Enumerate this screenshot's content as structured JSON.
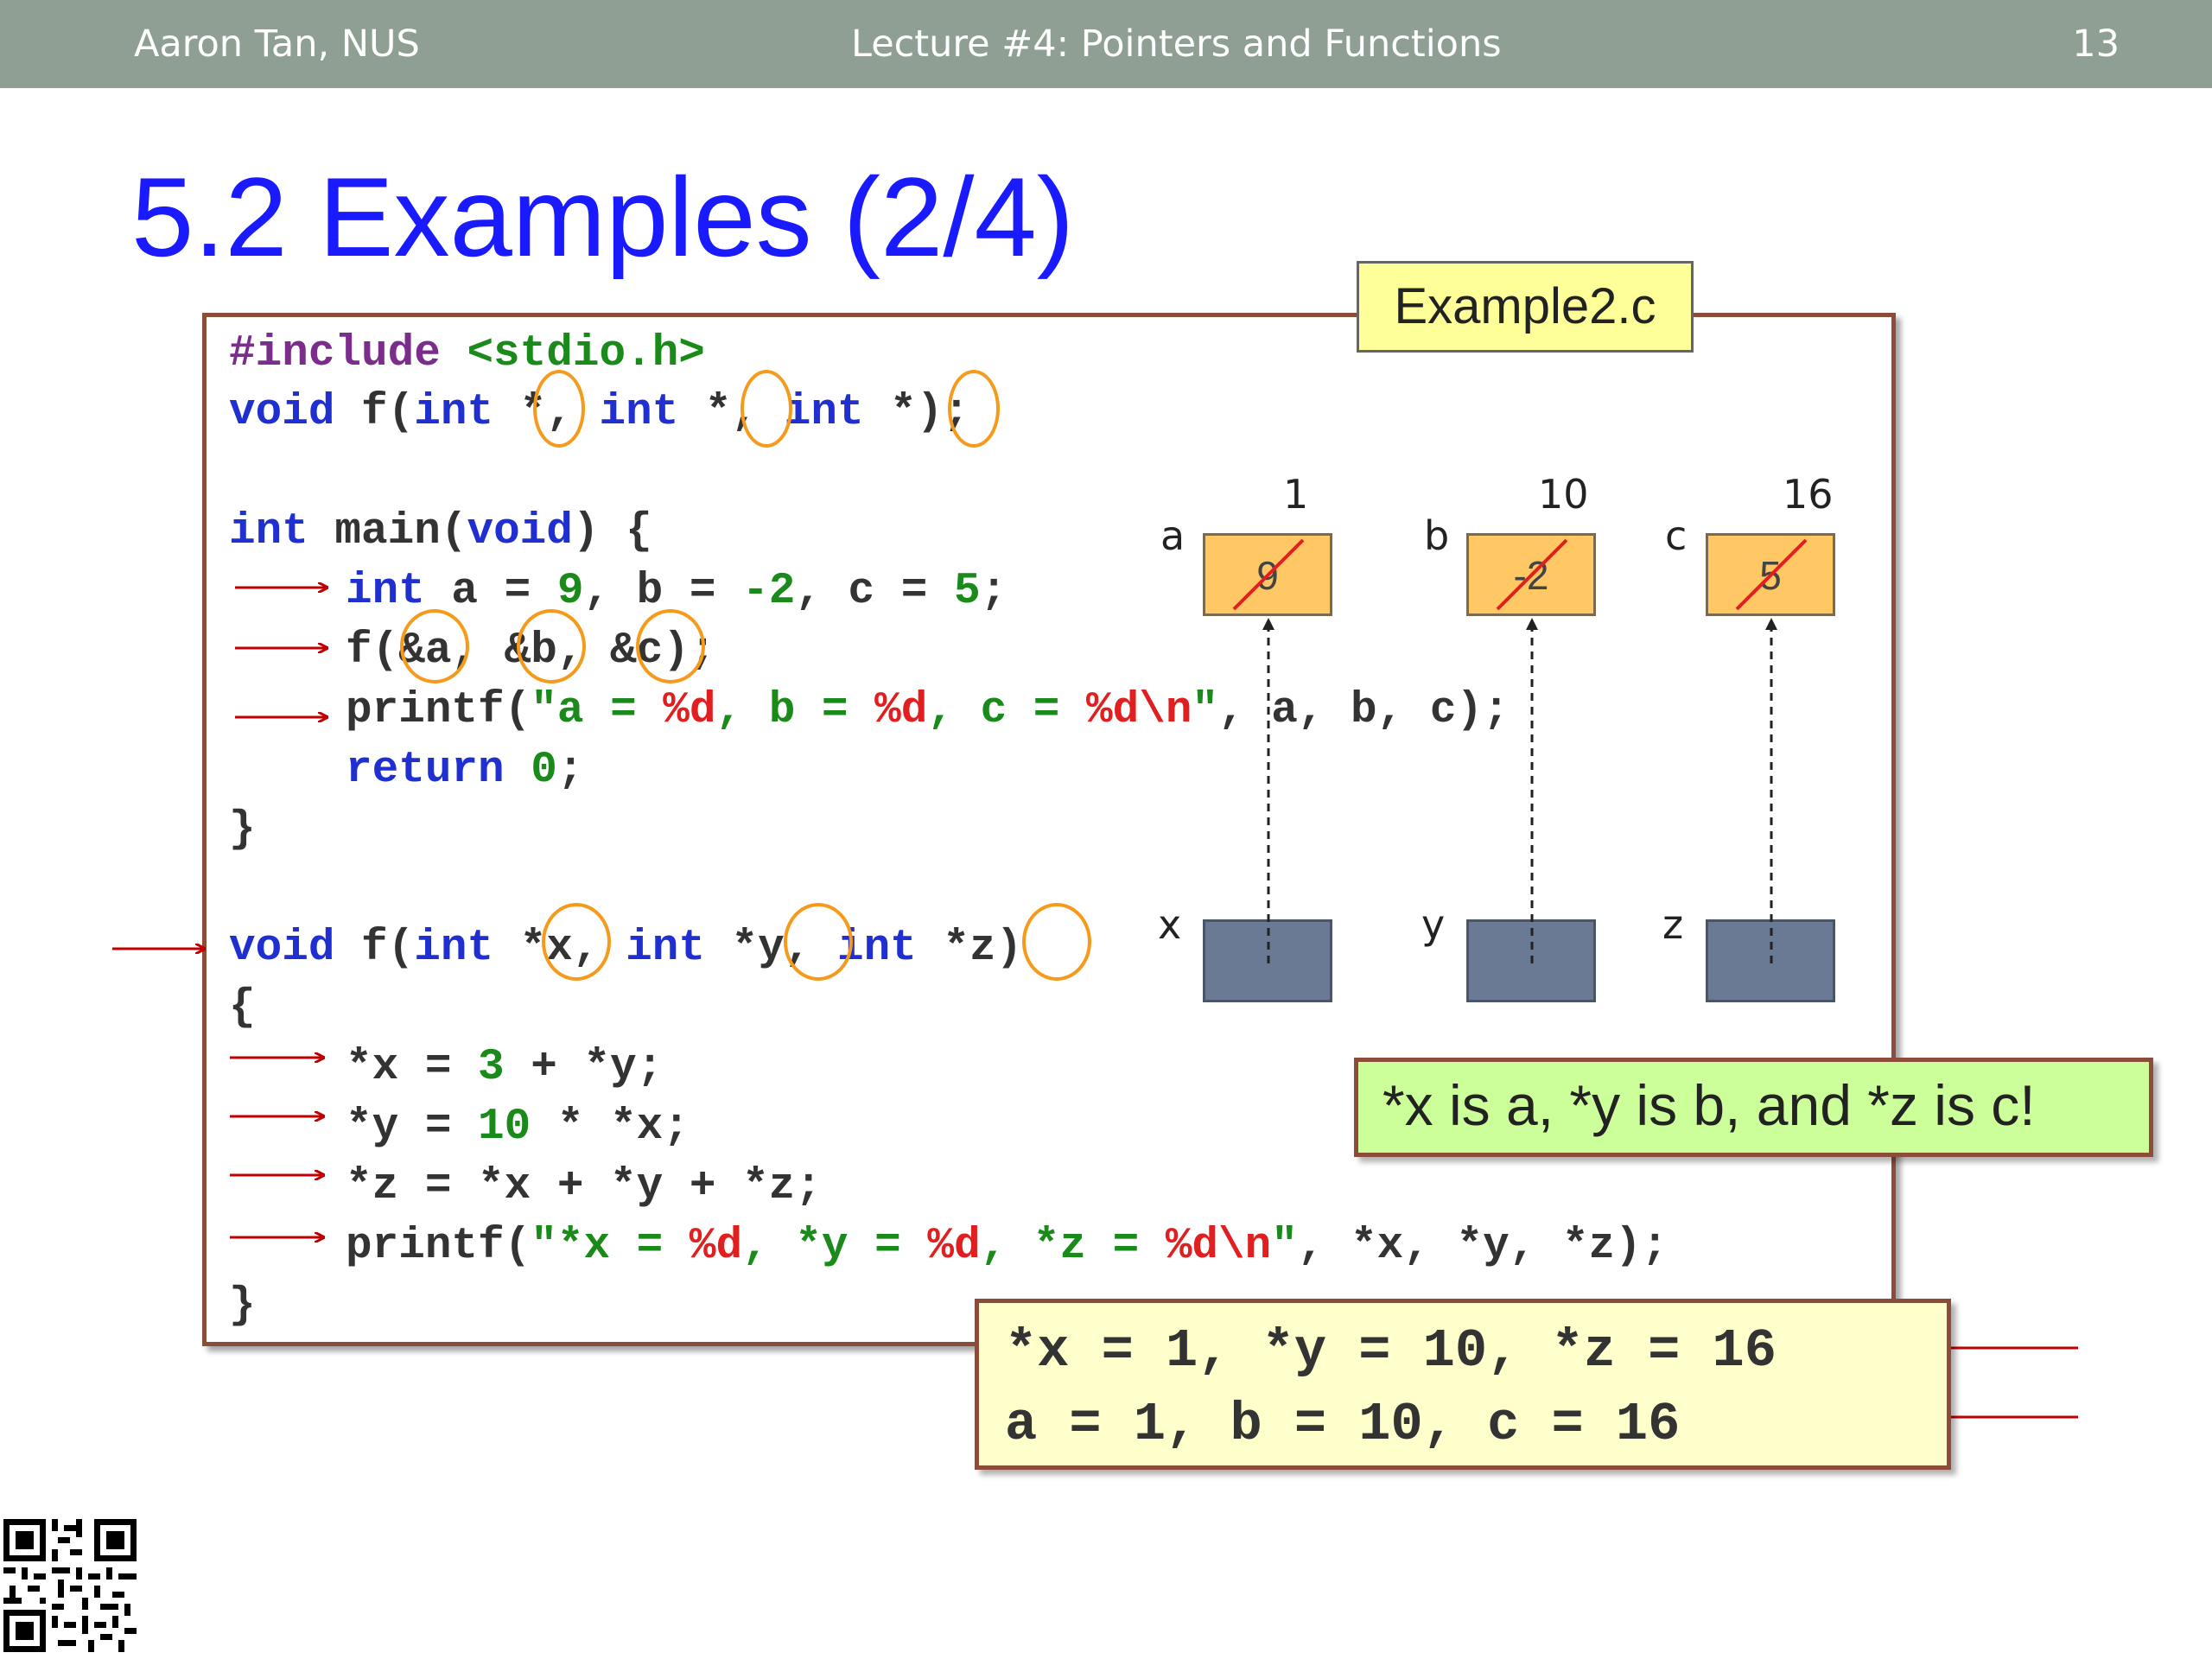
{
  "header": {
    "author": "Aaron Tan, NUS",
    "lecture": "Lecture #4: Pointers and Functions",
    "page_number": "13"
  },
  "slide": {
    "title": "5.2 Examples (2/4)",
    "filename": "Example2.c"
  },
  "code": {
    "l1_pp": "#include",
    "l1_inc": "<stdio.h>",
    "l2_void": "void",
    "l2_f": " f(",
    "l2_int1": "int",
    "l2_p1": " *, ",
    "l2_int2": "int",
    "l2_p2": " *, ",
    "l2_int3": "int",
    "l2_p3": " *);",
    "l3_int": "int",
    "l3_main": " main(",
    "l3_void": "void",
    "l3_rest": ") {",
    "l4_int": "int",
    "l4_a": " a = ",
    "l4_9": "9",
    "l4_b": ", b = ",
    "l4_m2": "-2",
    "l4_c": ", c = ",
    "l4_5": "5",
    "l4_end": ";",
    "l5": "f(&a, &b, &c);",
    "l6_fn": "printf(",
    "l6_s1": "\"a = ",
    "l6_f1": "%d",
    "l6_s2": ", b = ",
    "l6_f2": "%d",
    "l6_s3": ", c = ",
    "l6_f3": "%d\\n",
    "l6_s4": "\"",
    "l6_rest": ", a, b, c);",
    "l7_ret": "return",
    "l7_0": " 0",
    "l7_end": ";",
    "l8": "}",
    "l9_void": "void",
    "l9_f": " f(",
    "l9_int1": "int",
    "l9_x": " *x, ",
    "l9_int2": "int",
    "l9_y": " *y, ",
    "l9_int3": "int",
    "l9_z": " *z)",
    "l10": "{",
    "l11_a": "*x = ",
    "l11_3": "3",
    "l11_b": " + *y;",
    "l12_a": "*y = ",
    "l12_10": "10",
    "l12_b": " * *x;",
    "l13": "*z = *x + *y + *z;",
    "l14_fn": "printf(",
    "l14_s1": "\"*x = ",
    "l14_f1": "%d",
    "l14_s2": ", *y = ",
    "l14_f2": "%d",
    "l14_s3": ", *z = ",
    "l14_f3": "%d\\n",
    "l14_s4": "\"",
    "l14_rest": ", *x, *y, *z);",
    "l15": "}"
  },
  "memory": {
    "cells": [
      {
        "name": "a",
        "new_value": "1",
        "old_value": "9"
      },
      {
        "name": "b",
        "new_value": "10",
        "old_value": "-2"
      },
      {
        "name": "c",
        "new_value": "16",
        "old_value": "5"
      }
    ],
    "pointers": [
      {
        "name": "x"
      },
      {
        "name": "y"
      },
      {
        "name": "z"
      }
    ]
  },
  "note": "*x is a, *y is b, and *z is c!",
  "output": {
    "line1": "*x = 1, *y = 10, *z = 16",
    "line2": "a = 1, b = 10, c = 16"
  },
  "colors": {
    "header_bg": "#8f9f94",
    "title": "#1a1aff",
    "keyword": "#1f2fd0",
    "literal": "#1a8a1a",
    "format": "#e02020",
    "circle": "#f59a1a",
    "arrow": "#c00000",
    "cell_value": "#ffc864",
    "cell_pointer": "#6b7a94",
    "note_bg": "#ccff99",
    "output_bg": "#ffffcc"
  },
  "icons": [
    "qr-code-icon",
    "arrow-right-icon",
    "arrow-left-icon"
  ]
}
